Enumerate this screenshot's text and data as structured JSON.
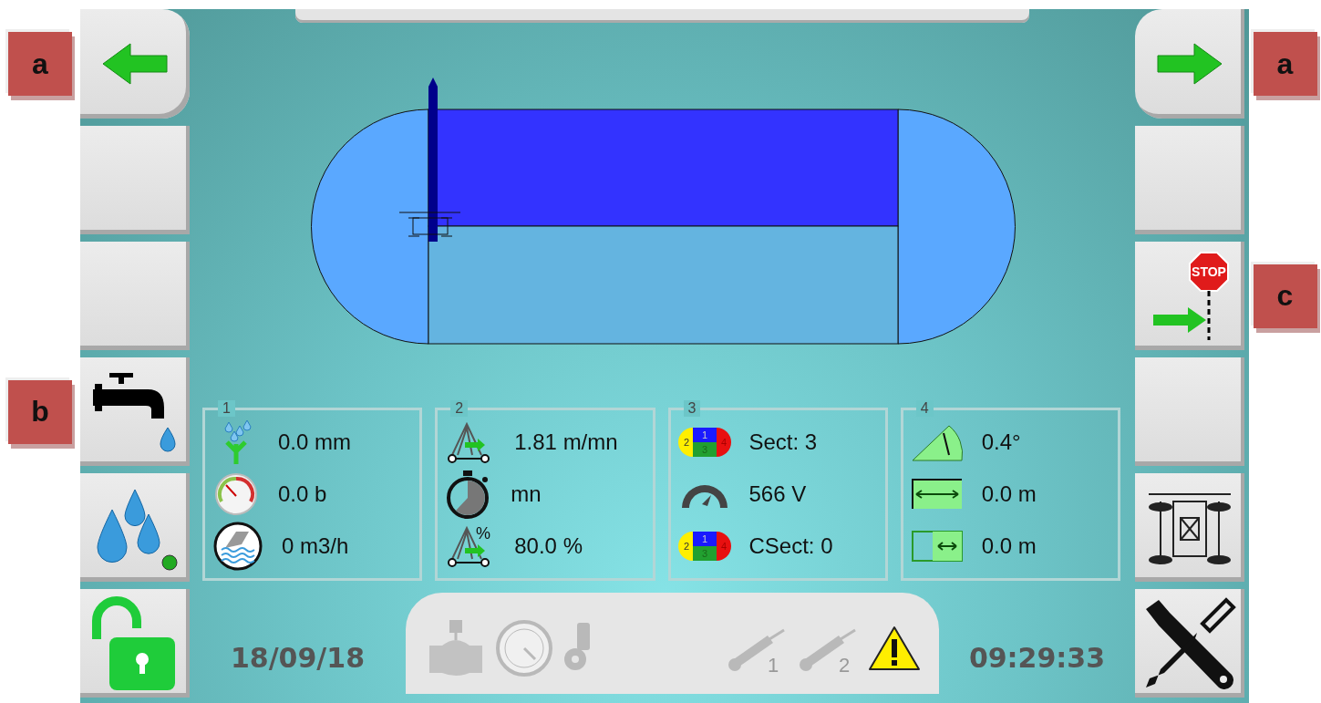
{
  "left_buttons": [
    {
      "kind": "back",
      "annotation": "a"
    },
    {
      "kind": "empty"
    },
    {
      "kind": "empty"
    },
    {
      "kind": "tap",
      "annotation": "b"
    },
    {
      "kind": "irrigation",
      "led_on": true
    },
    {
      "kind": "lock",
      "locked": false
    }
  ],
  "right_buttons": [
    {
      "kind": "forward",
      "annotation": "a"
    },
    {
      "kind": "empty"
    },
    {
      "kind": "stop_at_line",
      "annotation": "c",
      "sign_text": "STOP"
    },
    {
      "kind": "empty"
    },
    {
      "kind": "machine"
    },
    {
      "kind": "tools"
    }
  ],
  "panels": [
    {
      "number": "1",
      "rows": [
        {
          "kind": "rainfall",
          "value": "0.0 mm"
        },
        {
          "kind": "pressure",
          "value": "0.0 b"
        },
        {
          "kind": "flow",
          "value": "0 m3/h"
        }
      ]
    },
    {
      "number": "2",
      "rows": [
        {
          "kind": "speed",
          "value": "1.81 m/mn"
        },
        {
          "kind": "timer",
          "value": "mn"
        },
        {
          "kind": "speed_percent",
          "value": "80.0 %",
          "icon_label": "%"
        }
      ]
    },
    {
      "number": "3",
      "rows": [
        {
          "kind": "sections",
          "value": "Sect: 3",
          "icon_labels": [
            "1",
            "2",
            "3",
            "4"
          ]
        },
        {
          "kind": "voltage",
          "value": "566 V"
        },
        {
          "kind": "sections",
          "value": "CSect: 0",
          "icon_labels": [
            "1",
            "2",
            "3",
            "4"
          ]
        }
      ]
    },
    {
      "number": "4",
      "rows": [
        {
          "kind": "angle",
          "value": "0.4°"
        },
        {
          "kind": "width",
          "value": "0.0 m"
        },
        {
          "kind": "offset",
          "value": "0.0 m"
        }
      ]
    }
  ],
  "status_bar": {
    "date": "18/09/18",
    "time": "09:29:33",
    "icons": [
      {
        "kind": "valve",
        "active": false
      },
      {
        "kind": "gauge",
        "active": false
      },
      {
        "kind": "pump",
        "active": false
      },
      {
        "kind": "sensor",
        "label": "1",
        "active": false
      },
      {
        "kind": "sensor",
        "label": "2",
        "active": false
      },
      {
        "kind": "warning",
        "active": true
      }
    ]
  }
}
